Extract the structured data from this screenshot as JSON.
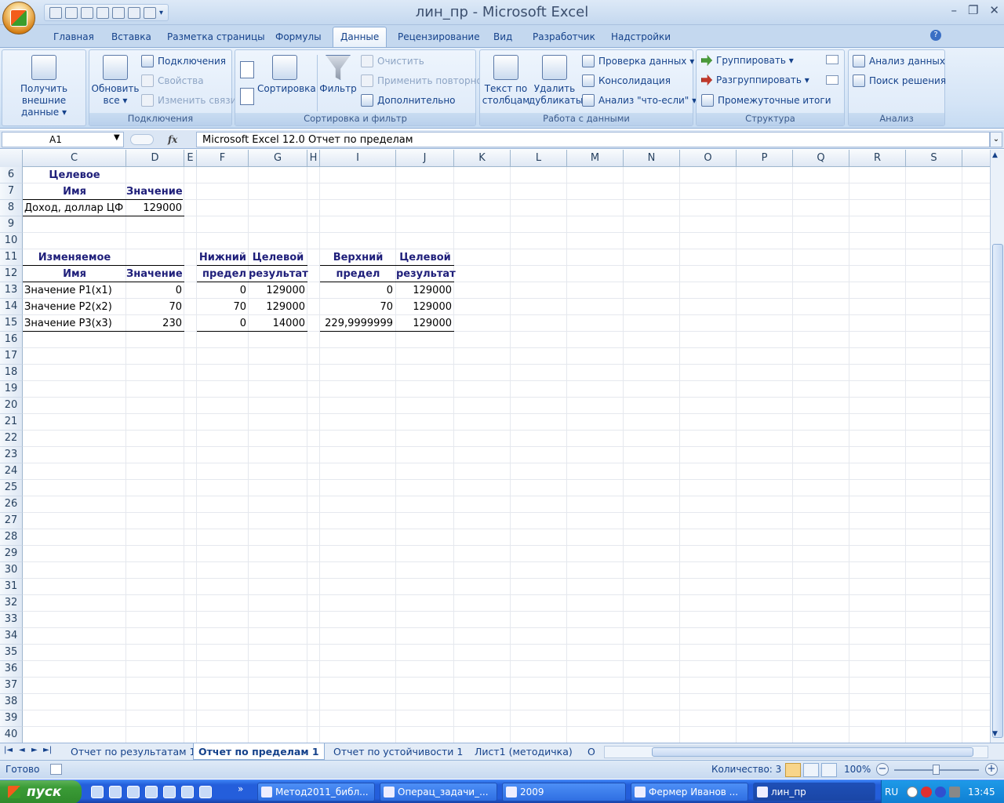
{
  "window": {
    "title": "лин_пр - Microsoft Excel",
    "minimize": "–",
    "restore": "❐",
    "close": "✕"
  },
  "ribbon_tabs": [
    "Главная",
    "Вставка",
    "Разметка страницы",
    "Формулы",
    "Данные",
    "Рецензирование",
    "Вид",
    "Разработчик",
    "Надстройки"
  ],
  "active_tab": "Данные",
  "ribbon": {
    "get_external": {
      "line1": "Получить",
      "line2": "внешние данные ▾"
    },
    "connections_group": {
      "label": "Подключения",
      "refresh_line1": "Обновить",
      "refresh_line2": "все ▾",
      "connections": "Подключения",
      "properties": "Свойства",
      "edit_links": "Изменить связи"
    },
    "sort_filter_group": {
      "label": "Сортировка и фильтр",
      "sort": "Сортировка",
      "filter": "Фильтр",
      "clear": "Очистить",
      "reapply": "Применить повторно",
      "advanced": "Дополнительно"
    },
    "data_tools_group": {
      "label": "Работа с данными",
      "text_to_columns_line1": "Текст по",
      "text_to_columns_line2": "столбцам",
      "remove_dup_line1": "Удалить",
      "remove_dup_line2": "дубликаты",
      "validation": "Проверка данных ▾",
      "consolidate": "Консолидация",
      "what_if": "Анализ \"что-если\" ▾"
    },
    "outline_group": {
      "label": "Структура",
      "group": "Группировать ▾",
      "ungroup": "Разгруппировать ▾",
      "subtotal": "Промежуточные итоги"
    },
    "analysis_group": {
      "label": "Анализ",
      "data_analysis": "Анализ данных",
      "solver": "Поиск решения"
    }
  },
  "formula_bar": {
    "name_box": "A1",
    "fx": "fx",
    "formula": "Microsoft Excel 12.0 Отчет по пределам"
  },
  "columns": [
    "C",
    "D",
    "E",
    "F",
    "G",
    "H",
    "I",
    "J",
    "K",
    "L",
    "M",
    "N",
    "O",
    "P",
    "Q",
    "R",
    "S"
  ],
  "rows": [
    6,
    7,
    8,
    9,
    10,
    11,
    12,
    13,
    14,
    15,
    16,
    17,
    18,
    19,
    20,
    21,
    22,
    23,
    24,
    25,
    26,
    27,
    28,
    29,
    30,
    31,
    32,
    33,
    34,
    35,
    36,
    37,
    38,
    39,
    40
  ],
  "cells": {
    "target_header": "Целевое",
    "target_name_hdr": "Имя",
    "target_value_hdr": "Значение",
    "target_name": "Доход, доллар ЦФ",
    "target_value": "129000",
    "var_header": "Изменяемое",
    "var_name_hdr": "Имя",
    "var_value_hdr": "Значение",
    "lower_hdr1": "Нижний",
    "lower_hdr2": "предел",
    "lower_target_hdr1": "Целевой",
    "lower_target_hdr2": "результат",
    "upper_hdr1": "Верхний",
    "upper_hdr2": "предел",
    "upper_target_hdr1": "Целевой",
    "upper_target_hdr2": "результат",
    "vars": [
      {
        "name": "Значение Р1(x1)",
        "value": "0",
        "lower": "0",
        "lower_target": "129000",
        "upper": "0",
        "upper_target": "129000"
      },
      {
        "name": "Значение Р2(x2)",
        "value": "70",
        "lower": "70",
        "lower_target": "129000",
        "upper": "70",
        "upper_target": "129000"
      },
      {
        "name": "Значение Р3(x3)",
        "value": "230",
        "lower": "0",
        "lower_target": "14000",
        "upper": "229,9999999",
        "upper_target": "129000"
      }
    ]
  },
  "sheet_tabs": [
    "Отчет по результатам 1",
    "Отчет по пределам 1",
    "Отчет по устойчивости 1",
    "Лист1 (методичка)",
    "О"
  ],
  "active_sheet": "Отчет по пределам 1",
  "status": {
    "ready": "Готово",
    "count": "Количество: 3",
    "zoom": "100%",
    "zoom_level_percent": 100
  },
  "taskbar": {
    "start": "пуск",
    "items": [
      "Метод2011_библ...",
      "Операц_задачи_...",
      "2009",
      "Фермер Иванов ...",
      "лин_пр"
    ],
    "active_item": "лин_пр",
    "lang": "RU",
    "time": "13:45"
  }
}
